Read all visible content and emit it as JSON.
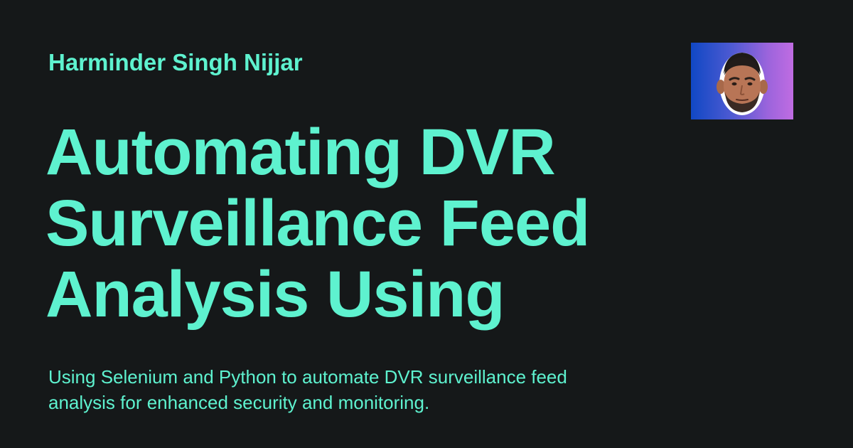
{
  "author": {
    "name": "Harminder Singh Nijjar"
  },
  "title": {
    "lines": [
      "Automating DVR",
      "Surveillance Feed",
      "Analysis Using"
    ]
  },
  "description": "Using Selenium and Python to automate DVR surveillance feed analysis for enhanced security and monitoring.",
  "avatar": {
    "icon": "author-avatar-photo"
  },
  "colors": {
    "background": "#151819",
    "accent": "#5ef2cf"
  }
}
